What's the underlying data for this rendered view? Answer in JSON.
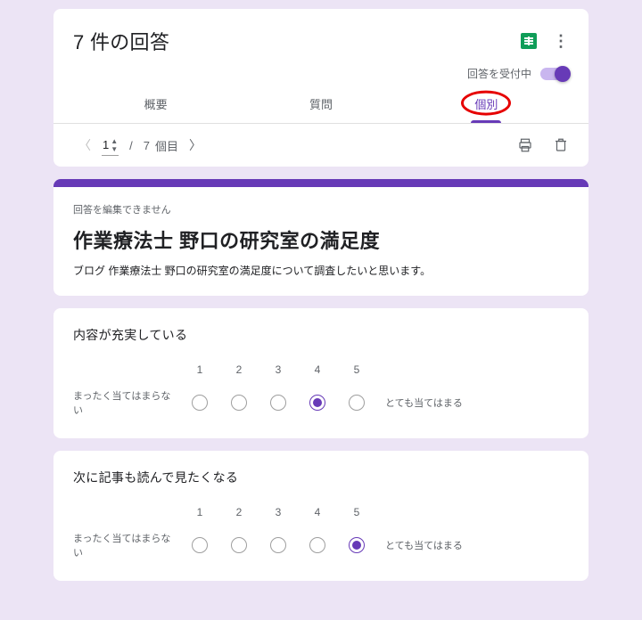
{
  "header": {
    "title": "7 件の回答",
    "accepting_label": "回答を受付中",
    "accepting": true,
    "tabs": [
      "概要",
      "質問",
      "個別"
    ],
    "active_tab": 2
  },
  "pager": {
    "current": "1",
    "total": "7",
    "unit": "個目"
  },
  "form": {
    "edit_notice": "回答を編集できません",
    "title": "作業療法士 野口の研究室の満足度",
    "description": "ブログ 作業療法士 野口の研究室の満足度について調査したいと思います。"
  },
  "scale": {
    "labels": [
      "1",
      "2",
      "3",
      "4",
      "5"
    ],
    "low_label": "まったく当てはまらない",
    "high_label": "とても当てはまる"
  },
  "questions": [
    {
      "title": "内容が充実している",
      "selected": 4
    },
    {
      "title": "次に記事も読んで見たくなる",
      "selected": 5
    }
  ],
  "annotation_color": "#e60000",
  "accent": "#673ab7"
}
